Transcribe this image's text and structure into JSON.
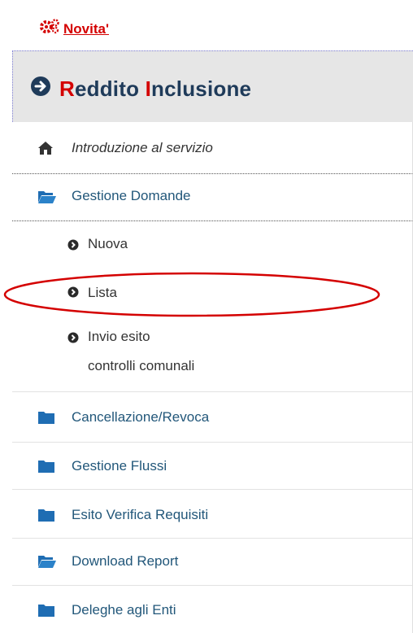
{
  "novita": {
    "label": "Novita'"
  },
  "header": {
    "r1": "R",
    "rest1": "eddito ",
    "r2": "I",
    "rest2": "nclusione"
  },
  "menu": {
    "intro": "Introduzione al servizio",
    "gestione_domande": "Gestione Domande",
    "sub": {
      "nuova": "Nuova",
      "lista": "Lista",
      "invio_line1": "Invio esito",
      "invio_line2": "controlli comunali"
    },
    "cancellazione": "Cancellazione/Revoca",
    "flussi": "Gestione Flussi",
    "esito": "Esito Verifica Requisiti",
    "download": "Download Report",
    "deleghe": "Deleghe agli Enti"
  },
  "colors": {
    "accent_red": "#d40000",
    "icon_blue": "#1f6db3",
    "title_navy": "#1f3b5a"
  }
}
